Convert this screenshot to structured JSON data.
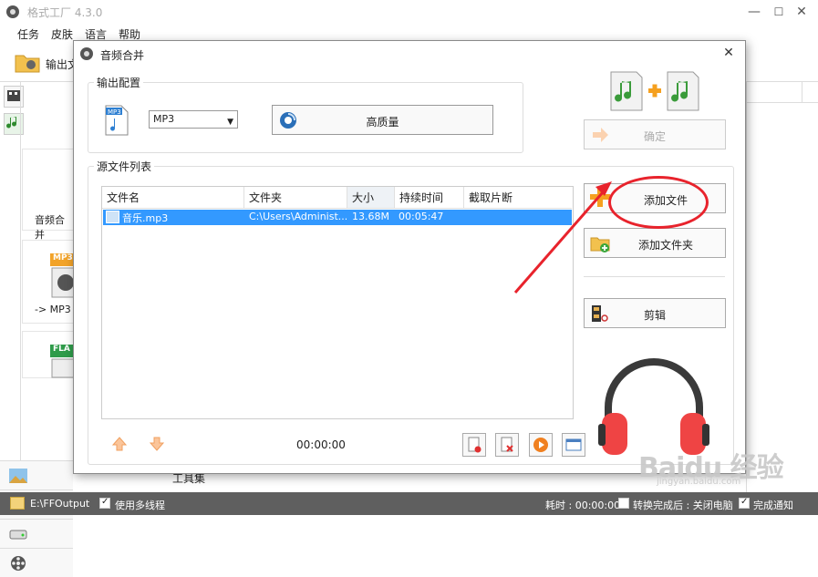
{
  "app": {
    "title": "格式工厂 4.3.0",
    "minimize": "—",
    "maximize": "☐",
    "close": "✕"
  },
  "menu": [
    "任务",
    "皮肤",
    "语言",
    "帮助"
  ],
  "toolbar": {
    "output_label": "输出文"
  },
  "left_panel": {
    "cards": [
      {
        "label": "音频合并"
      },
      {
        "label": "-> MP3",
        "badge": "MP3"
      },
      {
        "label": "",
        "badge": "FLA"
      }
    ],
    "toolset_label": "工具集"
  },
  "statusbar": {
    "output_path": "E:\\FFOutput",
    "multithread_label": "使用多线程",
    "elapsed_label": "耗时 : 00:00:00",
    "after_convert_label": "转换完成后 : 关闭电脑",
    "notify_label": "完成通知"
  },
  "dialog": {
    "title": "音频合并",
    "output_group": "输出配置",
    "format_value": "MP3",
    "quality_label": "高质量",
    "source_group": "源文件列表",
    "columns": [
      "文件名",
      "文件夹",
      "大小",
      "持续时间",
      "截取片断"
    ],
    "rows": [
      {
        "name": "音乐.mp3",
        "folder": "C:\\Users\\Administ...",
        "size": "13.68M",
        "duration": "00:05:47",
        "clip": ""
      }
    ],
    "total_time": "00:00:00",
    "buttons": {
      "confirm": "确定",
      "add_file": "添加文件",
      "add_folder": "添加文件夹",
      "edit": "剪辑"
    }
  },
  "watermark": {
    "big": "Baidu 经验",
    "small": "jingyan.baidu.com"
  },
  "colors": {
    "accent_red": "#e8232c",
    "selected_row": "#3399ff",
    "status_bg": "#5f5f5f"
  }
}
